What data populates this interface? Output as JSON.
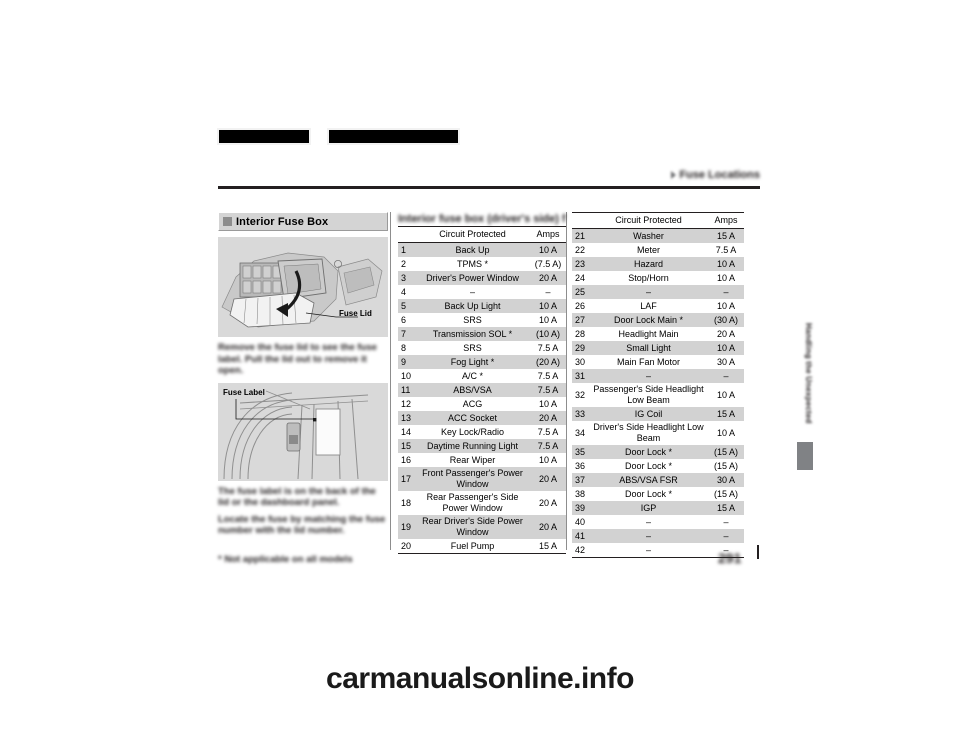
{
  "header": {
    "redacted_bar_1": "",
    "redacted_bar_2": "",
    "breadcrumb_blurred": "Fuse Locations"
  },
  "left_column": {
    "section_title": "Interior Fuse Box",
    "figure_engine": {
      "caption": "Fuse Lid",
      "name": "interior-fuse-box-photo"
    },
    "figure_dashboard": {
      "caption": "Fuse Label",
      "name": "fuse-label-location-photo"
    },
    "body_text_1": "Remove the fuse lid to see the fuse label. Pull the lid out to remove it open.",
    "body_text_2": "The fuse label is on the back of the lid or the dashboard panel.",
    "body_text_3": "Locate the fuse by matching the fuse number with the lid number."
  },
  "table_mid": {
    "blurred_title": "Interior fuse box (driver's side) fuse rating",
    "columns": [
      "",
      "Circuit Protected",
      "Amps"
    ],
    "rows": [
      {
        "no": "1",
        "circuit": "Back Up",
        "amps": "10 A",
        "tall": false
      },
      {
        "no": "2",
        "circuit": "TPMS *",
        "amps": "(7.5 A)",
        "tall": false
      },
      {
        "no": "3",
        "circuit": "Driver's Power Window",
        "amps": "20 A",
        "tall": false
      },
      {
        "no": "4",
        "circuit": "–",
        "amps": "–",
        "tall": false
      },
      {
        "no": "5",
        "circuit": "Back Up Light",
        "amps": "10 A",
        "tall": false
      },
      {
        "no": "6",
        "circuit": "SRS",
        "amps": "10 A",
        "tall": false
      },
      {
        "no": "7",
        "circuit": "Transmission SOL *",
        "amps": "(10 A)",
        "tall": false
      },
      {
        "no": "8",
        "circuit": "SRS",
        "amps": "7.5 A",
        "tall": false
      },
      {
        "no": "9",
        "circuit": "Fog Light *",
        "amps": "(20 A)",
        "tall": false
      },
      {
        "no": "10",
        "circuit": "A/C *",
        "amps": "7.5 A",
        "tall": false
      },
      {
        "no": "11",
        "circuit": "ABS/VSA",
        "amps": "7.5 A",
        "tall": false
      },
      {
        "no": "12",
        "circuit": "ACG",
        "amps": "10 A",
        "tall": false
      },
      {
        "no": "13",
        "circuit": "ACC Socket",
        "amps": "20 A",
        "tall": false
      },
      {
        "no": "14",
        "circuit": "Key Lock/Radio",
        "amps": "7.5 A",
        "tall": false
      },
      {
        "no": "15",
        "circuit": "Daytime Running Light",
        "amps": "7.5 A",
        "tall": false
      },
      {
        "no": "16",
        "circuit": "Rear Wiper",
        "amps": "10 A",
        "tall": false
      },
      {
        "no": "17",
        "circuit": "Front Passenger's Power Window",
        "amps": "20 A",
        "tall": true
      },
      {
        "no": "18",
        "circuit": "Rear Passenger's Side Power Window",
        "amps": "20 A",
        "tall": true
      },
      {
        "no": "19",
        "circuit": "Rear Driver's Side Power Window",
        "amps": "20 A",
        "tall": true
      },
      {
        "no": "20",
        "circuit": "Fuel Pump",
        "amps": "15 A",
        "tall": false
      }
    ]
  },
  "table_right": {
    "columns": [
      "",
      "Circuit Protected",
      "Amps"
    ],
    "rows": [
      {
        "no": "21",
        "circuit": "Washer",
        "amps": "15 A",
        "tall": false
      },
      {
        "no": "22",
        "circuit": "Meter",
        "amps": "7.5 A",
        "tall": false
      },
      {
        "no": "23",
        "circuit": "Hazard",
        "amps": "10 A",
        "tall": false
      },
      {
        "no": "24",
        "circuit": "Stop/Horn",
        "amps": "10 A",
        "tall": false
      },
      {
        "no": "25",
        "circuit": "–",
        "amps": "–",
        "tall": false
      },
      {
        "no": "26",
        "circuit": "LAF",
        "amps": "10 A",
        "tall": false
      },
      {
        "no": "27",
        "circuit": "Door Lock Main *",
        "amps": "(30 A)",
        "tall": false
      },
      {
        "no": "28",
        "circuit": "Headlight Main",
        "amps": "20 A",
        "tall": false
      },
      {
        "no": "29",
        "circuit": "Small Light",
        "amps": "10 A",
        "tall": false
      },
      {
        "no": "30",
        "circuit": "Main Fan Motor",
        "amps": "30 A",
        "tall": false
      },
      {
        "no": "31",
        "circuit": "–",
        "amps": "–",
        "tall": false
      },
      {
        "no": "32",
        "circuit": "Passenger's Side Headlight Low Beam",
        "amps": "10 A",
        "tall": true
      },
      {
        "no": "33",
        "circuit": "IG Coil",
        "amps": "15 A",
        "tall": false
      },
      {
        "no": "34",
        "circuit": "Driver's Side Headlight Low Beam",
        "amps": "10 A",
        "tall": true
      },
      {
        "no": "35",
        "circuit": "Door Lock *",
        "amps": "(15 A)",
        "tall": false
      },
      {
        "no": "36",
        "circuit": "Door Lock *",
        "amps": "(15 A)",
        "tall": false
      },
      {
        "no": "37",
        "circuit": "ABS/VSA FSR",
        "amps": "30 A",
        "tall": false
      },
      {
        "no": "38",
        "circuit": "Door Lock *",
        "amps": "(15 A)",
        "tall": false
      },
      {
        "no": "39",
        "circuit": "IGP",
        "amps": "15 A",
        "tall": false
      },
      {
        "no": "40",
        "circuit": "–",
        "amps": "–",
        "tall": false
      },
      {
        "no": "41",
        "circuit": "–",
        "amps": "–",
        "tall": false
      },
      {
        "no": "42",
        "circuit": "–",
        "amps": "–",
        "tall": false
      }
    ]
  },
  "side_tab": {
    "label_blurred": "Handling the Unexpected"
  },
  "footer": {
    "footnote_blurred": "* Not applicable on all models",
    "page_number_blurred": "291"
  },
  "watermark": "carmanualsonline.info",
  "colors": {
    "row_shade": "#d2d2d2",
    "figure_bg": "#d9d9d9",
    "banner_bg": "#d4d4d4",
    "rule": "#231f20",
    "tab": "#808285"
  }
}
